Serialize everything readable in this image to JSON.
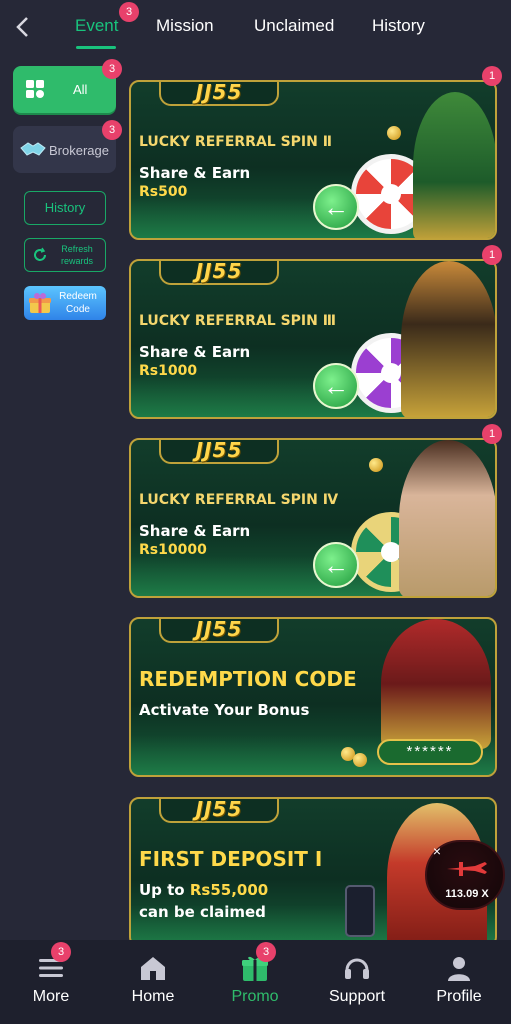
{
  "topnav": {
    "back_icon": "chevron-left-icon",
    "tabs": [
      {
        "label": "Event",
        "active": true,
        "badge": "3"
      },
      {
        "label": "Mission",
        "active": false
      },
      {
        "label": "Unclaimed",
        "active": false
      },
      {
        "label": "History",
        "active": false
      }
    ]
  },
  "sidebar": {
    "all": {
      "label": "All",
      "badge": "3",
      "icon": "grid-icon"
    },
    "brokerage": {
      "label": "Brokerage",
      "badge": "3",
      "icon": "handshake-icon"
    },
    "history": {
      "label": "History"
    },
    "refresh": {
      "label": "Refresh rewards",
      "icon": "refresh-icon"
    },
    "redeem": {
      "label": "Redeem Code",
      "icon": "gift-icon"
    }
  },
  "banners": [
    {
      "logo": "JJ55",
      "title": "LUCKY REFERRAL SPIN Ⅱ",
      "subtitle": "Share & Earn",
      "amount": "Rs500",
      "badge": "1"
    },
    {
      "logo": "JJ55",
      "title": "LUCKY REFERRAL SPIN Ⅲ",
      "subtitle": "Share & Earn",
      "amount": "Rs1000",
      "badge": "1"
    },
    {
      "logo": "JJ55",
      "title": "LUCKY REFERRAL SPIN Ⅳ",
      "subtitle": "Share & Earn",
      "amount": "Rs10000",
      "badge": "1"
    },
    {
      "logo": "JJ55",
      "title": "REDEMPTION CODE",
      "subtitle": "Activate Your Bonus",
      "code": "******"
    },
    {
      "logo": "JJ55",
      "title": "FIRST DEPOSIT Ⅰ",
      "line1_prefix": "Up to ",
      "line1_amount": "Rs55,000",
      "line2": "can be claimed"
    }
  ],
  "aviator": {
    "multiplier": "113.09 X",
    "close": "×"
  },
  "bottomnav": [
    {
      "label": "More",
      "icon": "menu-icon",
      "badge": "3",
      "active": false
    },
    {
      "label": "Home",
      "icon": "home-icon",
      "active": false
    },
    {
      "label": "Promo",
      "icon": "gift-icon",
      "badge": "3",
      "active": true
    },
    {
      "label": "Support",
      "icon": "headset-icon",
      "active": false
    },
    {
      "label": "Profile",
      "icon": "user-icon",
      "active": false
    }
  ],
  "colors": {
    "accent": "#19c37d",
    "badge": "#e8416b",
    "gold": "#ffd94a",
    "background": "#262837"
  }
}
